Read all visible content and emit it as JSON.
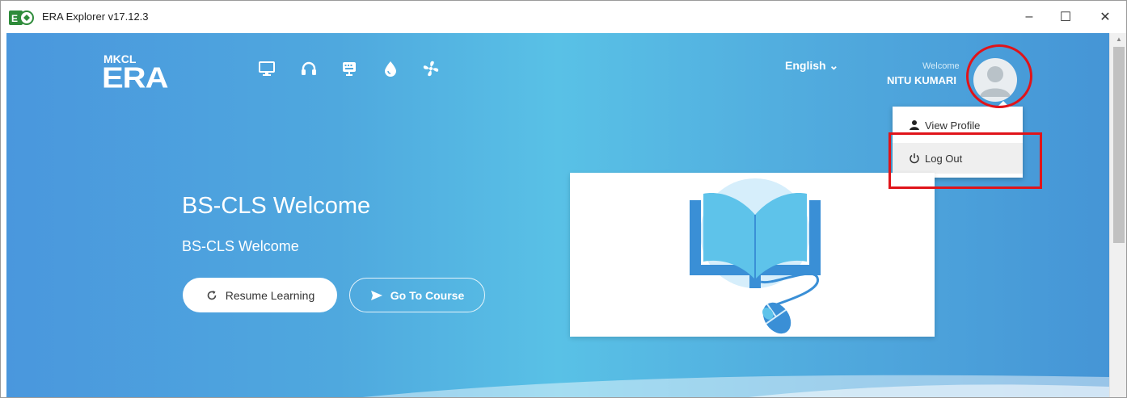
{
  "window": {
    "title": "ERA Explorer v17.12.3",
    "controls": {
      "minimize": "–",
      "maximize": "☐",
      "close": "✕"
    }
  },
  "header": {
    "logo_top": "MKCL",
    "logo_main": "ERA",
    "toolbar_icons": [
      "monitor-icon",
      "headphones-icon",
      "keyboard-icon",
      "drop-icon",
      "fan-icon"
    ],
    "language": "English ⌄",
    "welcome_label": "Welcome",
    "user_name": "NITU KUMARI"
  },
  "user_menu": {
    "items": [
      {
        "icon": "person-icon",
        "label": "View Profile"
      },
      {
        "icon": "power-icon",
        "label": "Log Out"
      }
    ]
  },
  "hero": {
    "title": "BS-CLS Welcome",
    "subtitle": "BS-CLS Welcome",
    "resume_label": "Resume Learning",
    "goto_label": "Go To Course"
  },
  "colors": {
    "accent_blue": "#4a97dd",
    "highlight_red": "#e0141a",
    "book_blue": "#3a8fd6",
    "book_light": "#5ec3ea"
  }
}
